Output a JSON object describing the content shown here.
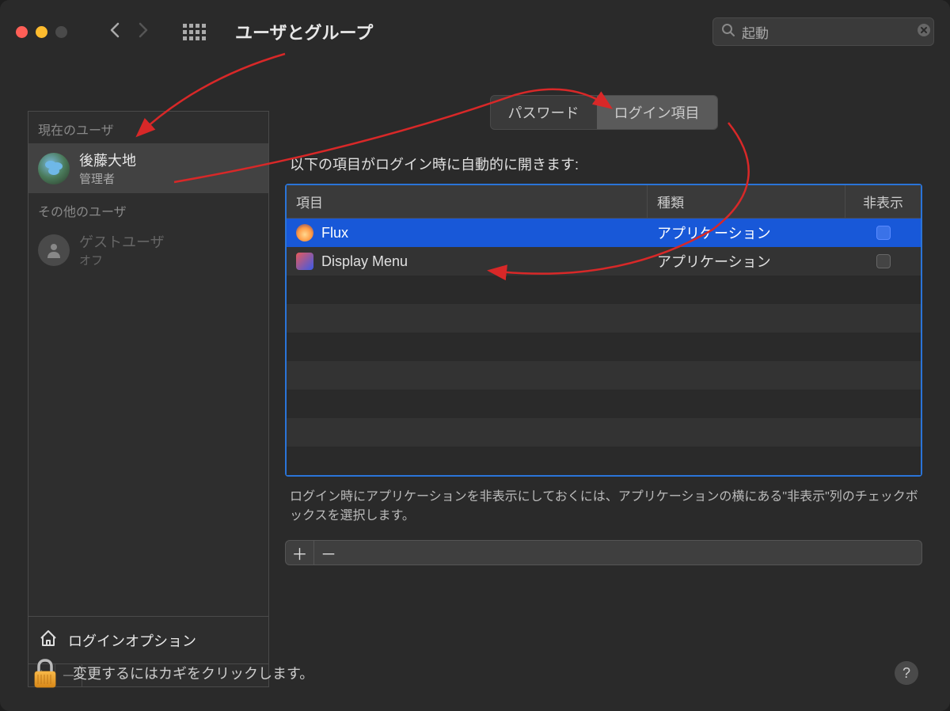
{
  "window": {
    "title": "ユーザとグループ"
  },
  "search": {
    "placeholder": "起動"
  },
  "sidebar": {
    "current_user_label": "現在のユーザ",
    "other_users_label": "その他のユーザ",
    "current_user": {
      "name": "後藤大地",
      "role": "管理者"
    },
    "guest_user": {
      "name": "ゲストユーザ",
      "status": "オフ"
    },
    "login_options_label": "ログインオプション"
  },
  "tabs": {
    "password": "パスワード",
    "login_items": "ログイン項目"
  },
  "main": {
    "instruction": "以下の項目がログイン時に自動的に開きます:",
    "columns": {
      "item": "項目",
      "kind": "種類",
      "hide": "非表示"
    },
    "rows": [
      {
        "name": "Flux",
        "kind": "アプリケーション",
        "icon": "flux",
        "selected": true
      },
      {
        "name": "Display Menu",
        "kind": "アプリケーション",
        "icon": "display",
        "selected": false
      }
    ],
    "hint": "ログイン時にアプリケーションを非表示にしておくには、アプリケーションの横にある\"非表示\"列のチェックボックスを選択します。"
  },
  "footer": {
    "lock_text": "変更するにはカギをクリックします。"
  }
}
